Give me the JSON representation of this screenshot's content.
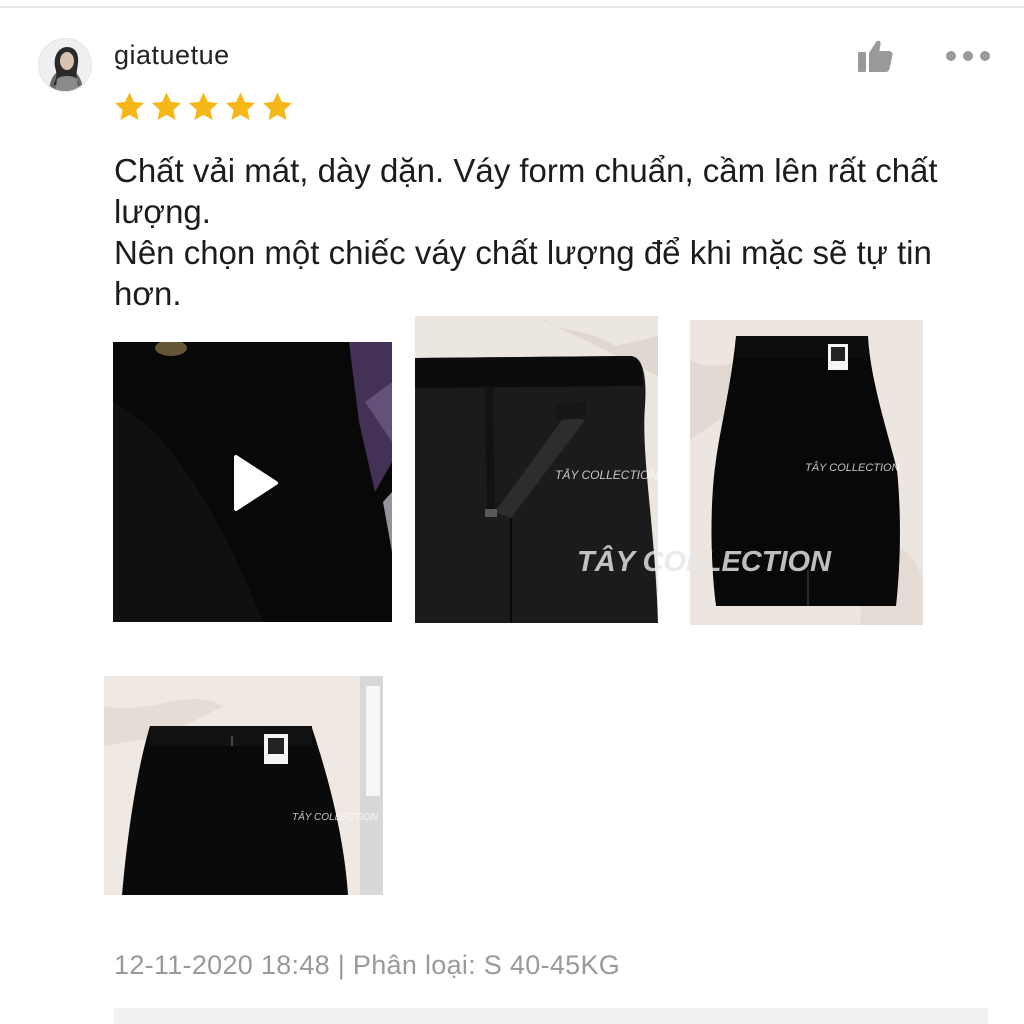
{
  "review": {
    "username": "giatuetue",
    "rating": 5,
    "max_rating": 5,
    "text_lines": [
      "Chất vải mát, dày dặn. Váy form chuẩn, cầm lên rất chất lượng.",
      "Nên chọn một chiếc váy chất lượng để khi mặc sẽ tự tin hơn."
    ],
    "meta": "12-11-2020 18:48 | Phân loại: S 40-45KG"
  },
  "media": {
    "watermark_small": "TÂY COLLECTION",
    "watermark_large": "TÂY COLLECTION",
    "items": [
      {
        "type": "video"
      },
      {
        "type": "photo"
      },
      {
        "type": "photo"
      },
      {
        "type": "photo"
      }
    ]
  },
  "icons": {
    "like": "thumbs-up-icon",
    "more": "more-dots-icon",
    "play": "play-icon",
    "star": "star-icon"
  },
  "colors": {
    "star": "#f6b818",
    "meta_text": "#9a9a9a",
    "icon_gray": "#9a9a9a"
  }
}
